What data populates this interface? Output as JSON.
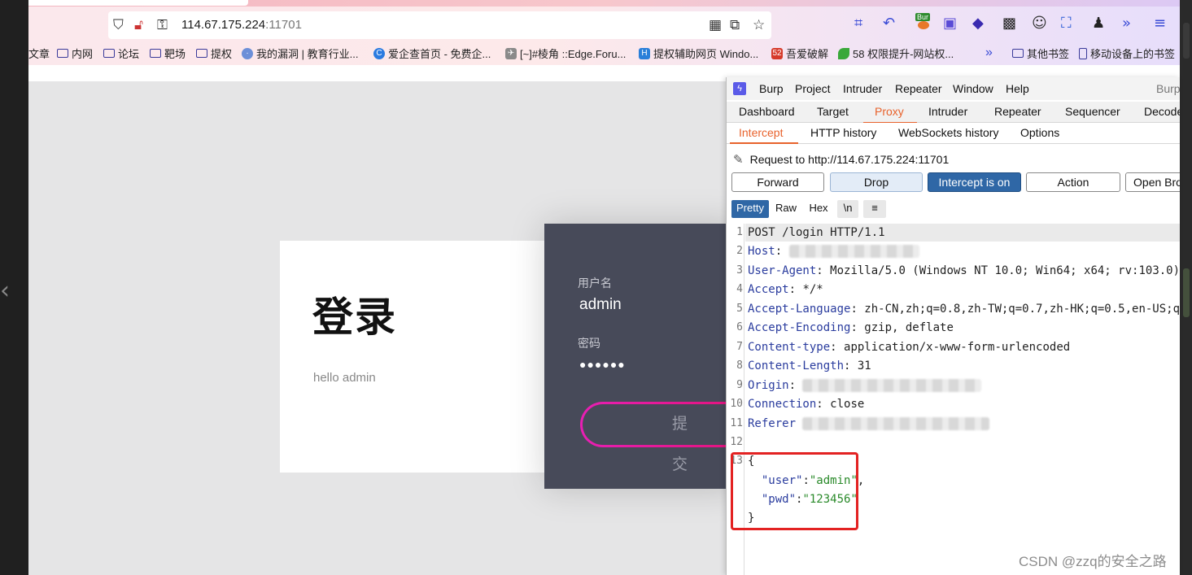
{
  "browser": {
    "url_host": "114.67.175.224",
    "url_port": ":11701",
    "bookmarks": [
      {
        "label": "文章",
        "icon": "none"
      },
      {
        "label": "内网",
        "icon": "folder-icon"
      },
      {
        "label": "论坛",
        "icon": "folder-icon"
      },
      {
        "label": "靶场",
        "icon": "folder-icon"
      },
      {
        "label": "提权",
        "icon": "folder-icon"
      },
      {
        "label": "我的漏洞 | 教育行业...",
        "icon": "globe-icon"
      },
      {
        "label": "爱企查首页 - 免费企...",
        "icon": "aiqicha-icon"
      },
      {
        "label": "[~]#棱角 ::Edge.Foru...",
        "icon": "edge-forum-icon"
      },
      {
        "label": "提权辅助网页 Windo...",
        "icon": "h-icon"
      },
      {
        "label": "吾爱破解",
        "icon": "52pojie-icon"
      },
      {
        "label": "58 权限提升-网站权...",
        "icon": "leaf-icon"
      },
      {
        "label": "其他书签",
        "icon": "folder-icon"
      },
      {
        "label": "移动设备上的书签",
        "icon": "mobile-icon"
      }
    ],
    "burp_badge": "Bur"
  },
  "page": {
    "title": "登录",
    "subtitle": "hello admin",
    "username_label": "用户名",
    "username_value": "admin",
    "password_label": "密码",
    "password_mask": "●●●●●●",
    "submit_label": "提交"
  },
  "burp": {
    "menu": [
      "Burp",
      "Project",
      "Intruder",
      "Repeater",
      "Window",
      "Help"
    ],
    "menu_right": "Burp",
    "main_tabs": [
      "Dashboard",
      "Target",
      "Proxy",
      "Intruder",
      "Repeater",
      "Sequencer",
      "Decode"
    ],
    "active_main_tab": "Proxy",
    "sub_tabs": [
      "Intercept",
      "HTTP history",
      "WebSockets history",
      "Options"
    ],
    "active_sub_tab": "Intercept",
    "request_to": "Request to http://114.67.175.224:11701",
    "buttons": {
      "forward": "Forward",
      "drop": "Drop",
      "intercept": "Intercept is on",
      "action": "Action",
      "open_browser": "Open Bro"
    },
    "format_tabs": [
      "Pretty",
      "Raw",
      "Hex",
      "\\n",
      "≡"
    ],
    "request_lines": [
      {
        "num": "1",
        "key": "",
        "value": "POST /login HTTP/1.1"
      },
      {
        "num": "2",
        "key": "Host",
        "value": ""
      },
      {
        "num": "3",
        "key": "User-Agent",
        "value": " Mozilla/5.0 (Windows NT 10.0; Win64; x64; rv:103.0) G"
      },
      {
        "num": "4",
        "key": "Accept",
        "value": " */*"
      },
      {
        "num": "5",
        "key": "Accept-Language",
        "value": " zh-CN,zh;q=0.8,zh-TW;q=0.7,zh-HK;q=0.5,en-US;q=0"
      },
      {
        "num": "6",
        "key": "Accept-Encoding",
        "value": " gzip, deflate"
      },
      {
        "num": "7",
        "key": "Content-type",
        "value": " application/x-www-form-urlencoded"
      },
      {
        "num": "8",
        "key": "Content-Length",
        "value": " 31"
      },
      {
        "num": "9",
        "key": "Origin",
        "value": ""
      },
      {
        "num": "10",
        "key": "Connection",
        "value": " close"
      },
      {
        "num": "11",
        "key": "Referer",
        "value": ""
      },
      {
        "num": "12",
        "key": "",
        "value": ""
      },
      {
        "num": "13",
        "key": "",
        "value": "{"
      },
      {
        "num": "",
        "key": "",
        "value": ""
      },
      {
        "num": "",
        "key": "",
        "value": ""
      },
      {
        "num": "",
        "key": "",
        "value": "}"
      }
    ],
    "body_user_key": "\"user\"",
    "body_user_val": "\"admin\"",
    "body_pwd_key": "\"pwd\"",
    "body_pwd_val": "\"123456\""
  },
  "watermark": "CSDN @zzq的安全之路"
}
